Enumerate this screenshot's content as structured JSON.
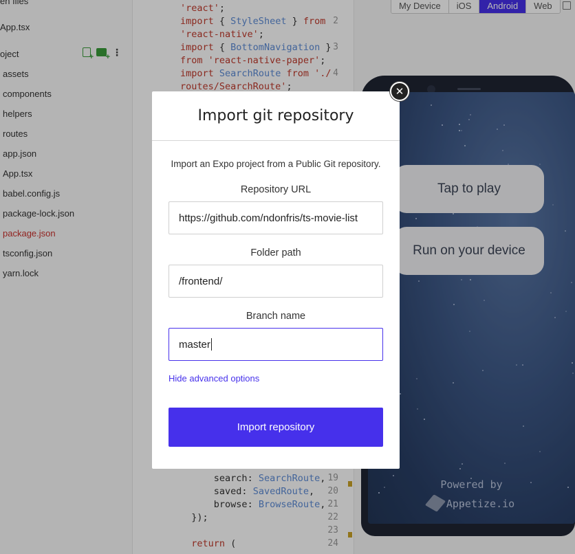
{
  "sidebar": {
    "top_partial": "en files",
    "open_file": "App.tsx",
    "project_header": "oject",
    "items": [
      "assets",
      "components",
      "helpers",
      "routes",
      "app.json",
      "App.tsx",
      "babel.config.js",
      "package-lock.json",
      "package.json",
      "tsconfig.json",
      "yarn.lock"
    ],
    "active_item": "package.json"
  },
  "editor": {
    "lines": [
      {
        "num": "",
        "tokens": [
          {
            "t": "'react'",
            "c": "str"
          },
          {
            "t": ";",
            "c": ""
          }
        ]
      },
      {
        "num": "2",
        "tokens": [
          {
            "t": "import",
            "c": "kw"
          },
          {
            "t": " { ",
            "c": ""
          },
          {
            "t": "StyleSheet",
            "c": "id"
          },
          {
            "t": " } ",
            "c": ""
          },
          {
            "t": "from",
            "c": "kw"
          }
        ]
      },
      {
        "num": "",
        "tokens": [
          {
            "t": "'react-native'",
            "c": "str"
          },
          {
            "t": ";",
            "c": ""
          }
        ]
      },
      {
        "num": "3",
        "tokens": [
          {
            "t": "import",
            "c": "kw"
          },
          {
            "t": " { ",
            "c": ""
          },
          {
            "t": "BottomNavigation",
            "c": "id"
          },
          {
            "t": " }",
            "c": ""
          }
        ]
      },
      {
        "num": "",
        "tokens": [
          {
            "t": "from",
            "c": "kw"
          },
          {
            "t": " ",
            "c": ""
          },
          {
            "t": "'react-native-paper'",
            "c": "str"
          },
          {
            "t": ";",
            "c": ""
          }
        ]
      },
      {
        "num": "4",
        "tokens": [
          {
            "t": "import",
            "c": "kw"
          },
          {
            "t": " ",
            "c": ""
          },
          {
            "t": "SearchRoute",
            "c": "id"
          },
          {
            "t": " ",
            "c": ""
          },
          {
            "t": "from",
            "c": "kw"
          },
          {
            "t": " ",
            "c": ""
          },
          {
            "t": "'./",
            "c": "str"
          }
        ]
      },
      {
        "num": "",
        "tokens": [
          {
            "t": "routes/SearchRoute'",
            "c": "str"
          },
          {
            "t": ";",
            "c": ""
          }
        ]
      }
    ],
    "lower_lines": [
      {
        "num": "19",
        "indent": "      ",
        "tokens": [
          {
            "t": "search",
            "c": ""
          },
          {
            "t": ": ",
            "c": ""
          },
          {
            "t": "SearchRoute",
            "c": "id"
          },
          {
            "t": ",",
            "c": ""
          }
        ]
      },
      {
        "num": "20",
        "indent": "      ",
        "tokens": [
          {
            "t": "saved",
            "c": ""
          },
          {
            "t": ": ",
            "c": ""
          },
          {
            "t": "SavedRoute",
            "c": "id"
          },
          {
            "t": ",",
            "c": ""
          }
        ]
      },
      {
        "num": "21",
        "indent": "      ",
        "tokens": [
          {
            "t": "browse",
            "c": ""
          },
          {
            "t": ": ",
            "c": ""
          },
          {
            "t": "BrowseRoute",
            "c": "id"
          },
          {
            "t": ",",
            "c": ""
          }
        ]
      },
      {
        "num": "22",
        "indent": "  ",
        "tokens": [
          {
            "t": "});",
            "c": ""
          }
        ]
      },
      {
        "num": "23",
        "indent": "",
        "tokens": []
      },
      {
        "num": "24",
        "indent": "  ",
        "tokens": [
          {
            "t": "return",
            "c": "kw"
          },
          {
            "t": " (",
            "c": ""
          }
        ]
      }
    ]
  },
  "preview": {
    "device_tabs": [
      "My Device",
      "iOS",
      "Android",
      "Web"
    ],
    "active_tab": "Android",
    "tap_to_play": "Tap to play",
    "run_on_device": "Run on your device",
    "powered_by": "Powered by",
    "appetize": "Appetize.io"
  },
  "modal": {
    "title": "Import git repository",
    "close_glyph": "✕",
    "description": "Import an Expo project from a Public Git repository.",
    "repo_label": "Repository URL",
    "repo_value": "https://github.com/ndonfris/ts-movie-list",
    "folder_label": "Folder path",
    "folder_value": "/frontend/",
    "branch_label": "Branch name",
    "branch_value": "master",
    "advanced_link": "Hide advanced options",
    "submit_label": "Import repository"
  },
  "colors": {
    "accent": "#4630eb",
    "active_file": "#c9302c"
  }
}
